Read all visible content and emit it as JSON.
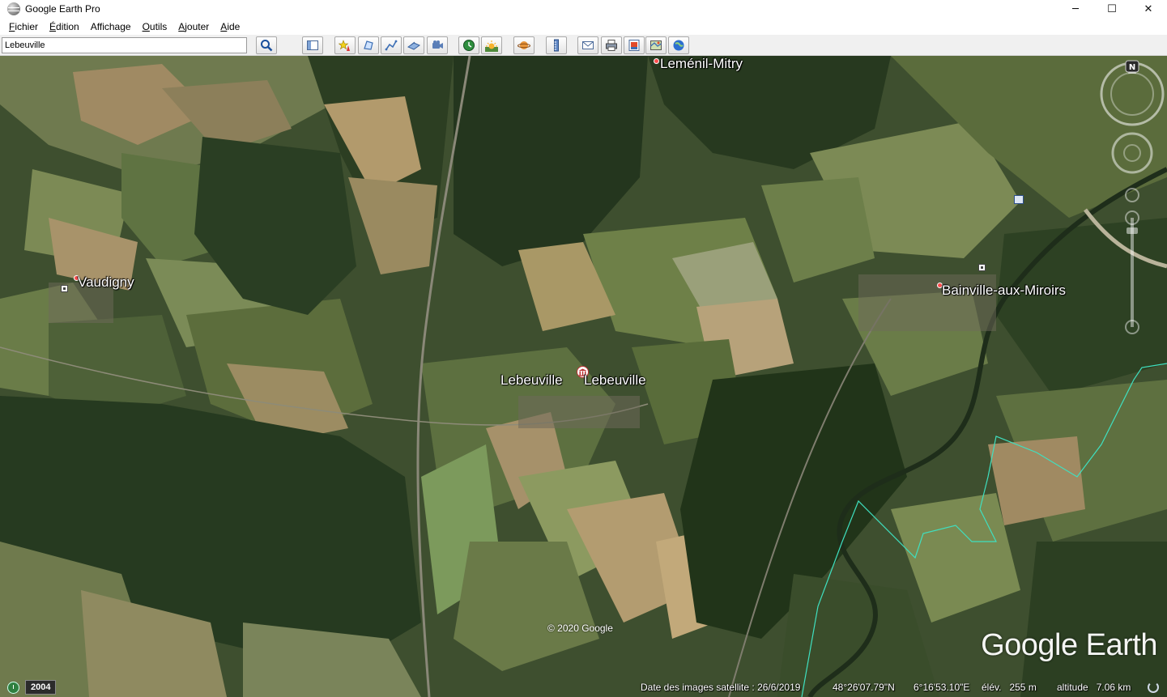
{
  "window": {
    "title": "Google Earth Pro",
    "controls": {
      "minimize": "─",
      "maximize": "☐",
      "close": "✕"
    }
  },
  "menu": [
    {
      "label": "Fichier",
      "mnemonic": "F",
      "rest": "ichier"
    },
    {
      "label": "Édition",
      "mnemonic": "É",
      "rest": "dition"
    },
    {
      "label": "Affichage",
      "mnemonic": "",
      "rest": "Affichage"
    },
    {
      "label": "Outils",
      "mnemonic": "O",
      "rest": "utils"
    },
    {
      "label": "Ajouter",
      "mnemonic": "A",
      "rest": "jouter"
    },
    {
      "label": "Aide",
      "mnemonic": "A",
      "rest": "ide"
    }
  ],
  "search": {
    "value": "Lebeuville"
  },
  "toolbar": [
    "search-icon",
    "sidebar-toggle-icon",
    "add-placemark-icon",
    "add-polygon-icon",
    "add-path-icon",
    "add-image-overlay-icon",
    "record-tour-icon",
    "historical-imagery-icon",
    "sunlight-icon",
    "switch-planet-icon",
    "ruler-icon",
    "email-icon",
    "print-icon",
    "save-image-icon",
    "view-in-maps-icon",
    "earth-gallery-icon"
  ],
  "map": {
    "places": [
      {
        "name": "Leménil-Mitry"
      },
      {
        "name": "Vaudigny"
      },
      {
        "name": "Bainville-aux-Miroirs"
      },
      {
        "name": "Lebeuville"
      },
      {
        "name": "Lebeuville"
      }
    ],
    "copyright": "© 2020 Google",
    "watermark": "Google Earth",
    "compass_north": "N"
  },
  "status": {
    "year": "2004",
    "imagery_date": "Date des images satellite : 26/6/2019",
    "lat": "48°26'07.79\"N",
    "lon": "6°16'53.10\"E",
    "elevation": "élév.   255 m",
    "altitude": "altitude   7.06 km"
  },
  "colors": {
    "forest": "#2a3d22",
    "field_light": "#9a8a63",
    "field_green": "#5d7040",
    "boundary": "#3fe0c0"
  }
}
